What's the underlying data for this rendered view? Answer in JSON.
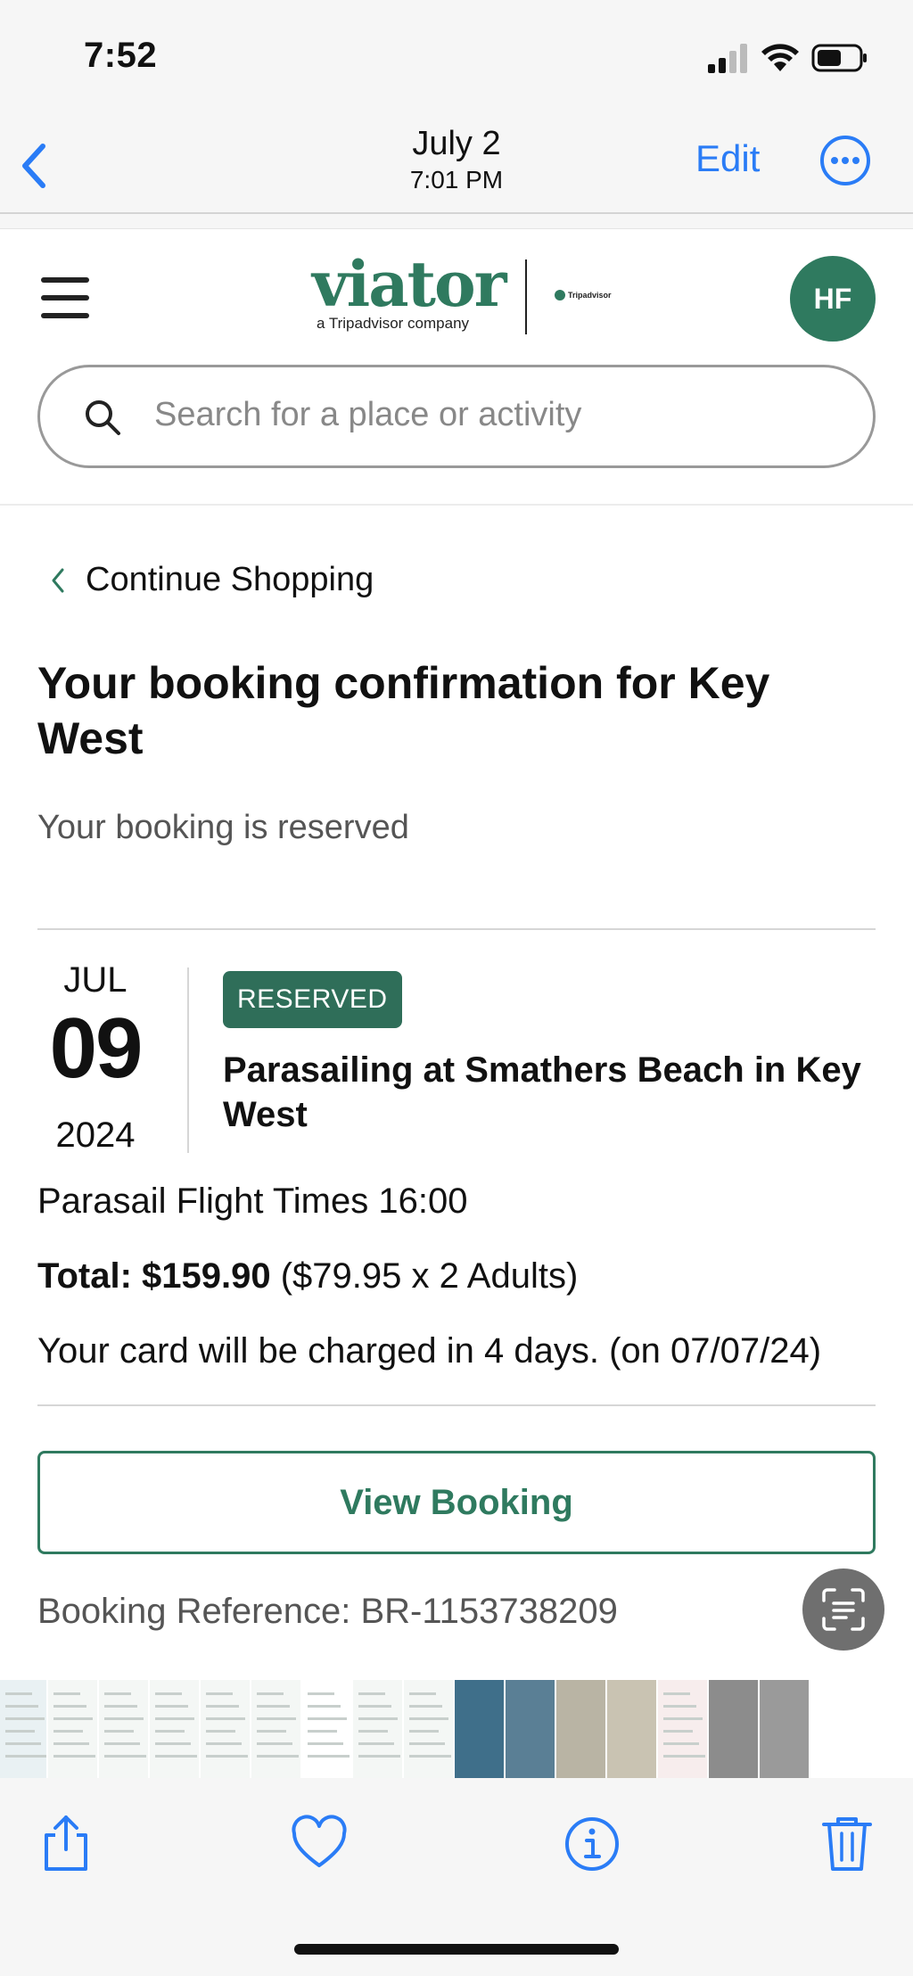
{
  "status_bar": {
    "time": "7:52"
  },
  "photos_nav": {
    "date": "July 2",
    "time": "7:01 PM",
    "edit_label": "Edit"
  },
  "site": {
    "brand": "viator",
    "tagline": "a Tripadvisor company",
    "partner": "Tripadvisor",
    "avatar_initials": "HF",
    "search_placeholder": "Search for a place or activity",
    "accent_color": "#2f7a5f"
  },
  "page": {
    "continue_label": "Continue Shopping",
    "title": "Your booking confirmation for Key West",
    "status_text": "Your booking is reserved"
  },
  "booking": {
    "month": "JUL",
    "day": "09",
    "year": "2024",
    "badge": "RESERVED",
    "tour_name": "Parasailing at Smathers Beach in Key West",
    "flight_time": "Parasail Flight Times 16:00",
    "total_label": "Total: $159.90",
    "total_breakdown": " ($79.95 x 2 Adults)",
    "charge_note": "Your card will be charged in 4 days. (on 07/07/24)",
    "view_button": "View Booking",
    "reference": "Booking Reference: BR-1153738209"
  },
  "thumbnail_strip": [
    {
      "kind": "screenshot",
      "color": "#e9f1f3"
    },
    {
      "kind": "screenshot",
      "color": "#f4f7f5"
    },
    {
      "kind": "screenshot",
      "color": "#f4f7f5"
    },
    {
      "kind": "screenshot",
      "color": "#f4f7f5"
    },
    {
      "kind": "screenshot",
      "color": "#f4f7f5"
    },
    {
      "kind": "screenshot",
      "color": "#f4f7f5"
    },
    {
      "kind": "screenshot",
      "color": "#ffffff"
    },
    {
      "kind": "screenshot",
      "color": "#f4f7f5"
    },
    {
      "kind": "screenshot",
      "color": "#f4f7f5"
    },
    {
      "kind": "photo",
      "color": "#3f6f8a"
    },
    {
      "kind": "photo",
      "color": "#5a7f95"
    },
    {
      "kind": "photo",
      "color": "#b9b4a4"
    },
    {
      "kind": "photo",
      "color": "#c9c3b2"
    },
    {
      "kind": "screenshot",
      "color": "#f7eded"
    },
    {
      "kind": "photo",
      "color": "#8c8c8c"
    },
    {
      "kind": "photo",
      "color": "#9a9a9a"
    }
  ],
  "toolbar": {
    "items": [
      "share-icon",
      "heart-icon",
      "info-icon",
      "trash-icon"
    ]
  }
}
